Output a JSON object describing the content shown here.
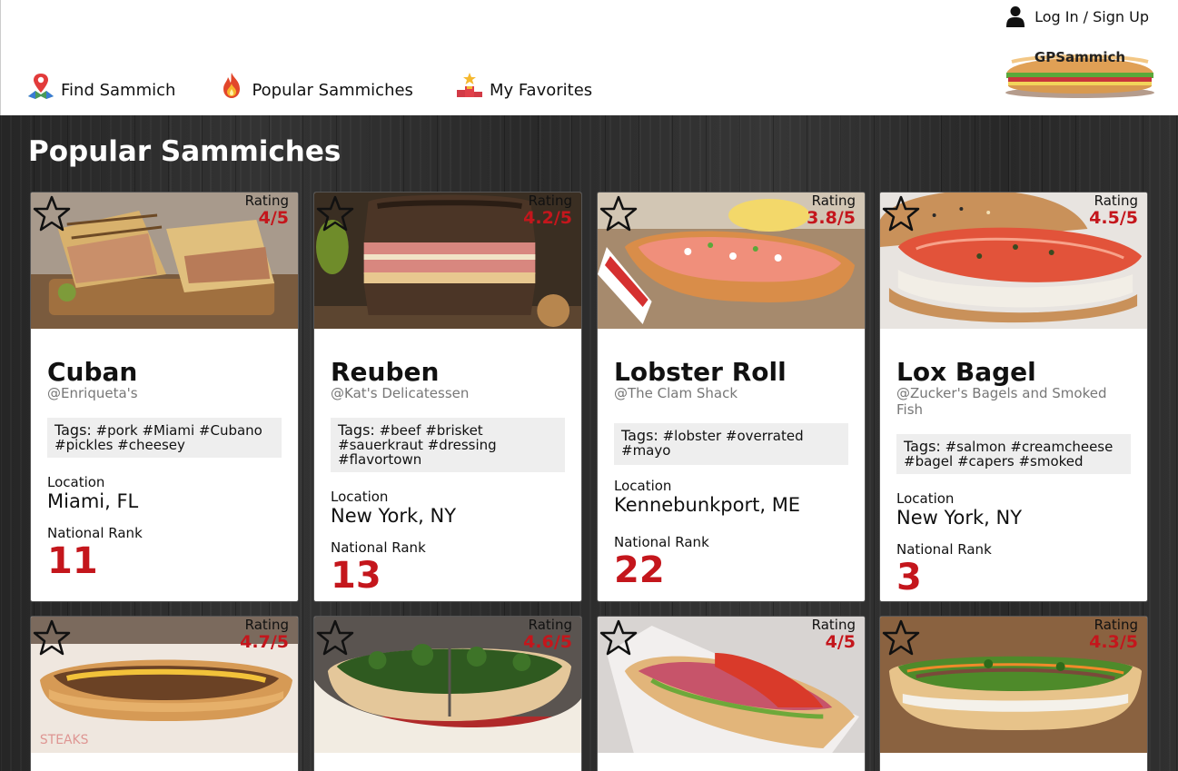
{
  "header": {
    "login_label": "Log In / Sign Up",
    "logo_text": "GPSammich",
    "nav": [
      {
        "label": "Find Sammich",
        "icon": "map-pin-icon"
      },
      {
        "label": "Popular Sammiches",
        "icon": "flame-icon"
      },
      {
        "label": "My Favorites",
        "icon": "trophy-icon"
      }
    ]
  },
  "main": {
    "title": "Popular Sammiches",
    "rating_label": "Rating",
    "tags_label": "Tags:",
    "location_label": "Location",
    "rank_label": "National Rank",
    "cards": [
      {
        "name": "Cuban",
        "place": "@Enriqueta's",
        "rating": "4/5",
        "tags": "#pork #Miami #Cubano #pickles #cheesey",
        "location": "Miami, FL",
        "rank": "11"
      },
      {
        "name": "Reuben",
        "place": "@Kat's Delicatessen",
        "rating": "4.2/5",
        "tags": "#beef #brisket #sauerkraut #dressing #flavortown",
        "location": "New York, NY",
        "rank": "13"
      },
      {
        "name": "Lobster Roll",
        "place": "@The Clam Shack",
        "rating": "3.8/5",
        "tags": "#lobster #overrated #mayo",
        "location": "Kennebunkport, ME",
        "rank": "22"
      },
      {
        "name": "Lox Bagel",
        "place": "@Zucker's Bagels and Smoked Fish",
        "rating": "4.5/5",
        "tags": "#salmon #creamcheese #bagel #capers #smoked",
        "location": "New York, NY",
        "rank": "3"
      },
      {
        "rating": "4.7/5"
      },
      {
        "rating": "4.6/5"
      },
      {
        "rating": "4/5"
      },
      {
        "rating": "4.3/5"
      }
    ]
  },
  "colors": {
    "accent": "#c4161c",
    "tag_bg": "#eeeeee"
  }
}
